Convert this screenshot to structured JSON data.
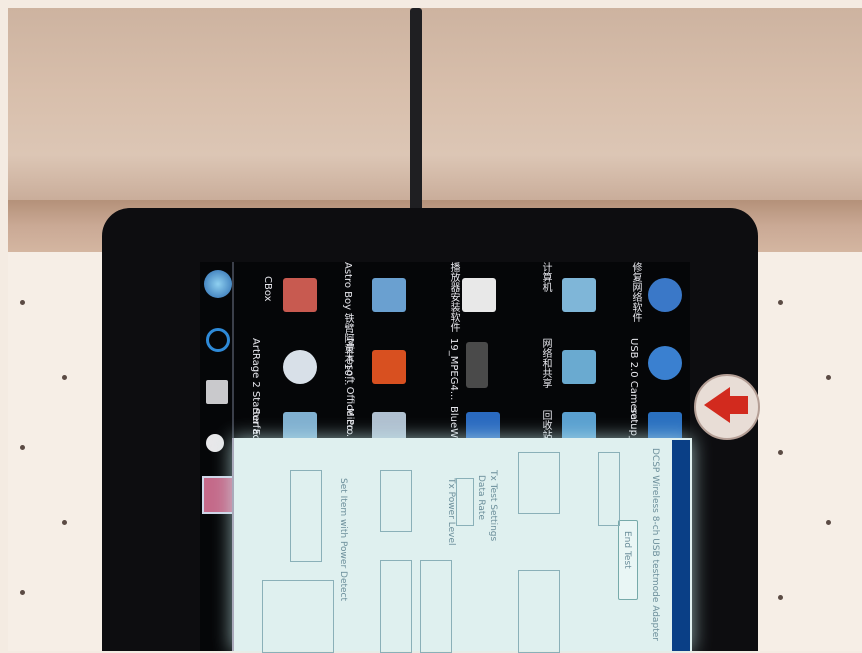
{
  "desktop_icons": [
    {
      "label": "CBox",
      "color": "#c85a50"
    },
    {
      "label": "Astro Boy 铁臂阿童木10...",
      "color": "#6aa0d0"
    },
    {
      "label": "播放器安装软件",
      "color": "#e8e8e8"
    },
    {
      "label": "计算机",
      "color": "#7fb6d8"
    },
    {
      "label": "修复网络软件",
      "color": "#3a78c8"
    },
    {
      "label": "ArtRage 2 Starter E...",
      "color": "#d8e0e8"
    },
    {
      "label": "Microsoft Office Po...",
      "color": "#d85020"
    },
    {
      "label": "19_MPEG4...",
      "color": "#4a4a4a"
    },
    {
      "label": "网络和共享",
      "color": "#6aaad0"
    },
    {
      "label": "USB 2.0 Camera ...",
      "color": "#3a80d0"
    },
    {
      "label": "Surfac",
      "color": "#80b0d0"
    },
    {
      "label": "Micro Surfac",
      "color": "#b0c0d0"
    },
    {
      "label": "BlueW",
      "color": "#2a6ac0"
    },
    {
      "label": "回收站",
      "color": "#5aa0d0"
    },
    {
      "label": "setup_b",
      "color": "#2a70c0"
    }
  ],
  "dialog": {
    "title": "DCSP Wireless 8-ch USB testmode Adapter",
    "end_test_label": "End Test",
    "tx_test_settings_label": "Tx Test Settings",
    "data_rate_label": "Data Rate",
    "tx_power_level_label": "Tx Power Level",
    "power_detect_label": "Set Item with Power Detect"
  },
  "colors": {
    "taskbar_accent": "#0a3f86",
    "home_arrow": "#d22a1e"
  }
}
